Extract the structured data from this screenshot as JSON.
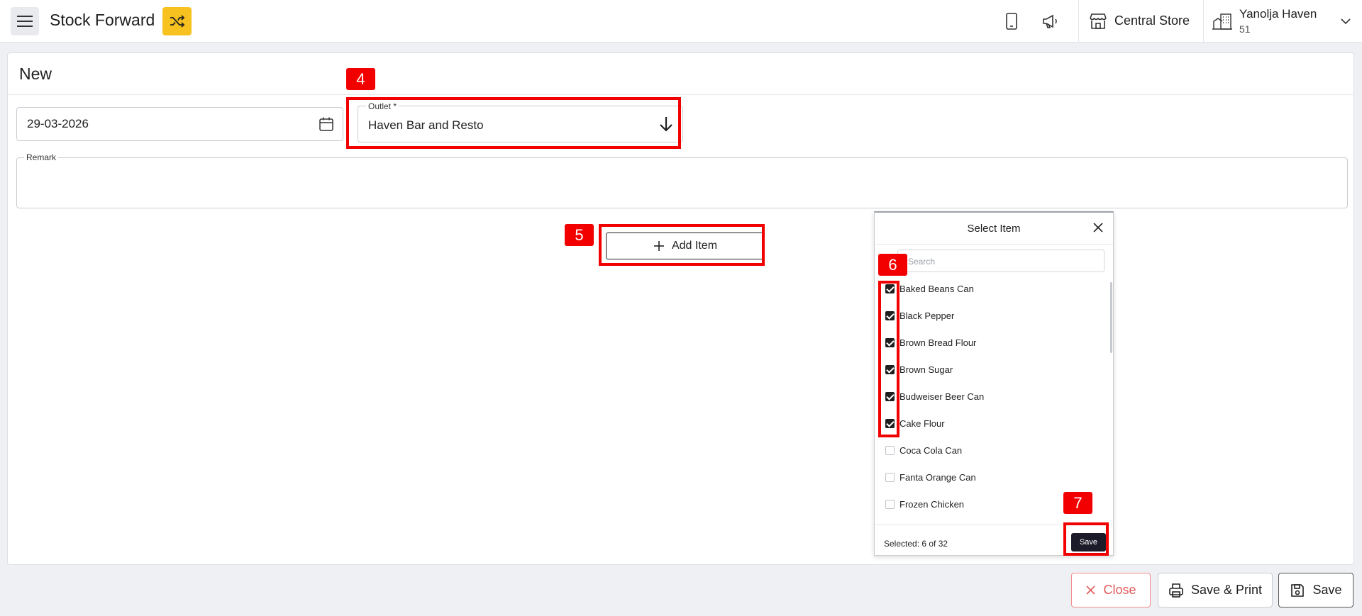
{
  "header": {
    "title": "Stock Forward",
    "store_name": "Central Store",
    "hotel_name": "Yanolja Haven",
    "hotel_id": "51"
  },
  "form": {
    "page_title": "New",
    "date_value": "29-03-2026",
    "outlet_label": "Outlet *",
    "outlet_value": "Haven Bar and Resto",
    "remark_label": "Remark",
    "add_item_label": "Add Item"
  },
  "select_item": {
    "title": "Select Item",
    "search_placeholder": "Search",
    "items": [
      {
        "label": "Baked Beans Can",
        "checked": true
      },
      {
        "label": "Black Pepper",
        "checked": true
      },
      {
        "label": "Brown Bread Flour",
        "checked": true
      },
      {
        "label": "Brown Sugar",
        "checked": true
      },
      {
        "label": "Budweiser Beer Can",
        "checked": true
      },
      {
        "label": "Cake Flour",
        "checked": true
      },
      {
        "label": "Coca Cola Can",
        "checked": false
      },
      {
        "label": "Fanta Orange Can",
        "checked": false
      },
      {
        "label": "Frozen Chicken",
        "checked": false
      }
    ],
    "selected_count": "Selected: 6 of 32",
    "save_label": "Save"
  },
  "annotations": [
    "4",
    "5",
    "6",
    "7"
  ],
  "footer": {
    "close_label": "Close",
    "save_print_label": "Save & Print",
    "save_label": "Save"
  },
  "colors": {
    "accent_yellow": "#f7c11f",
    "annotation_red": "#f20000",
    "close_red": "#e35a5a",
    "dark_button": "#1b1b2a"
  }
}
